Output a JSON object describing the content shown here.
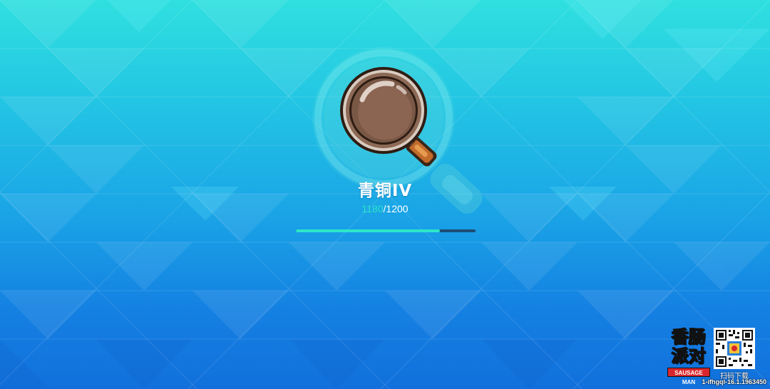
{
  "rank": {
    "name": "青铜IV",
    "icon": "frying-pan-icon"
  },
  "score": {
    "current": "1180",
    "separator": "/",
    "max": "1200"
  },
  "progress": {
    "fraction": 0.8
  },
  "branding": {
    "logo_text": "香肠派对",
    "logo_sub": "SAUSAGE MAN",
    "qr_caption": "扫码下载",
    "version": "1-ifhgql-16.1.1963450"
  },
  "colors": {
    "bg_top": "#2fe0df",
    "bg_bottom": "#1270dc",
    "accent": "#2ee6c9",
    "track": "#1d4d73"
  }
}
